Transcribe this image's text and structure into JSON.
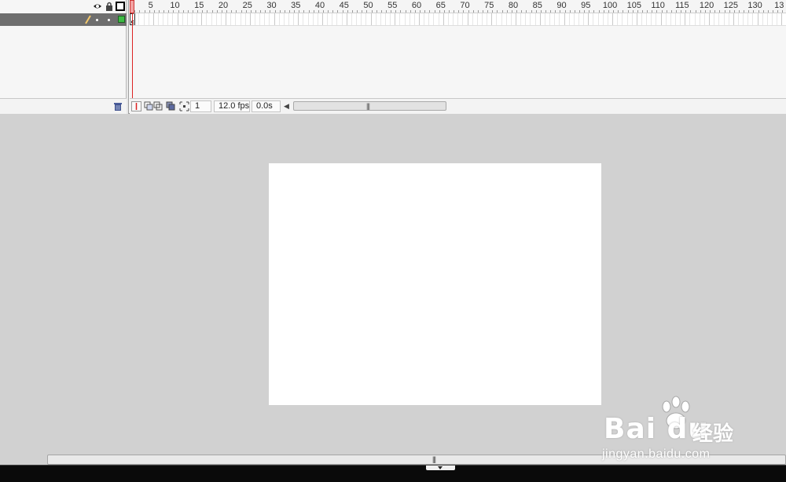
{
  "timeline": {
    "ruler_ticks": [
      "5",
      "10",
      "15",
      "20",
      "25",
      "30",
      "35",
      "40",
      "45",
      "50",
      "55",
      "60",
      "65",
      "70",
      "75",
      "80",
      "85",
      "90",
      "95",
      "100",
      "105",
      "110",
      "115",
      "120",
      "125",
      "130",
      "13"
    ],
    "current_frame": "1",
    "frame_rate": "12.0 fps",
    "elapsed_time": "0.0s",
    "layer_color": "#3dbb44",
    "playhead_color": "#dd2222"
  },
  "stage": {
    "background": "#ffffff"
  },
  "watermark": {
    "brand": "Bai du",
    "chinese": "经验",
    "url": "jingyan.baidu.com"
  }
}
